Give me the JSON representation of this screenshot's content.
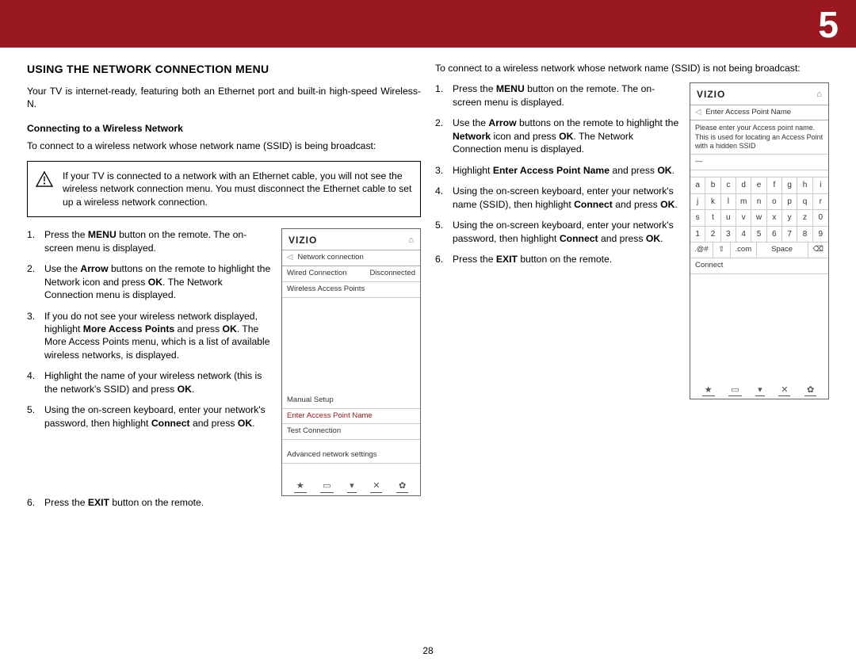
{
  "chapter_number": "5",
  "page_number": "28",
  "section_heading": "USING THE NETWORK CONNECTION MENU",
  "intro": "Your TV is internet-ready, featuring both an Ethernet port and built-in high-speed Wireless-N.",
  "sub1_heading": "Connecting to a Wireless Network",
  "sub1_lead": "To connect to a wireless network whose network name (SSID) is being broadcast:",
  "warning_text": "If your TV is connected to a network with an Ethernet cable, you will not see the wireless network connection menu. You must disconnect the Ethernet cable to set up a wireless network connection.",
  "steps1": [
    {
      "pre": "Press the ",
      "b1": "MENU",
      "post": " button on the remote. The on-screen menu is displayed."
    },
    {
      "pre": "Use the ",
      "b1": "Arrow",
      "mid": " buttons on the remote to highlight the Network icon and press ",
      "b2": "OK",
      "post": ". The Network Connection menu is displayed."
    },
    {
      "pre": "If you do not see your wireless network displayed, highlight ",
      "b1": "More Access Points",
      "mid": " and press ",
      "b2": "OK",
      "post": ". The More Access Points menu, which is a list of available wireless networks, is displayed."
    },
    {
      "pre": "Highlight the name of your wireless network (this is the network's SSID) and press ",
      "b1": "OK",
      "post": "."
    },
    {
      "pre": "Using the on-screen keyboard, enter your network's password, then highlight ",
      "b1": "Connect",
      "mid": " and press ",
      "b2": "OK",
      "post": "."
    },
    {
      "pre": "Press the ",
      "b1": "EXIT",
      "post": " button on the remote."
    }
  ],
  "panel1": {
    "logo": "VIZIO",
    "title": "Network connection",
    "wired_label": "Wired Connection",
    "wired_value": "Disconnected",
    "wireless": "Wireless Access Points",
    "manual": "Manual Setup",
    "enter_ap": "Enter Access Point Name",
    "test": "Test Connection",
    "advanced": "Advanced network settings"
  },
  "col2_lead": "To connect to a wireless network whose network name (SSID) is not being broadcast:",
  "steps2": [
    {
      "pre": "Press the ",
      "b1": "MENU",
      "post": " button on the remote. The on-screen menu is displayed."
    },
    {
      "pre": "Use the ",
      "b1": "Arrow",
      "mid": " buttons on the remote to highlight the ",
      "b2": "Network",
      "mid2": " icon and press ",
      "b3": "OK",
      "post": ". The Network Connection menu is displayed."
    },
    {
      "pre": "Highlight ",
      "b1": "Enter Access Point Name",
      "mid": " and press ",
      "b2": "OK",
      "post": "."
    },
    {
      "pre": "Using the on-screen keyboard, enter your network's name (SSID), then highlight ",
      "b1": "Connect",
      "mid": " and press ",
      "b2": "OK",
      "post": "."
    },
    {
      "pre": "Using the on-screen keyboard, enter your network's password, then highlight ",
      "b1": "Connect",
      "mid": " and press ",
      "b2": "OK",
      "post": "."
    },
    {
      "pre": "Press the ",
      "b1": "EXIT",
      "post": " button on the remote."
    }
  ],
  "panel2": {
    "logo": "VIZIO",
    "title": "Enter Access Point Name",
    "note": "Please enter your Access point name. This is used for locating an Access Point with a hidden SSID",
    "keys_alpha": [
      "a",
      "b",
      "c",
      "d",
      "e",
      "f",
      "g",
      "h",
      "i",
      "j",
      "k",
      "l",
      "m",
      "n",
      "o",
      "p",
      "q",
      "r",
      "s",
      "t",
      "u",
      "v",
      "w",
      "x",
      "y",
      "z",
      "0",
      "1",
      "2",
      "3",
      "4",
      "5",
      "6",
      "7",
      "8",
      "9"
    ],
    "key_sym": ".@#",
    "key_shift": "⇧",
    "key_com": ".com",
    "key_space": "Space",
    "key_del": "⌫",
    "connect": "Connect"
  },
  "toolbar_icons": [
    "★",
    "▭",
    "▾",
    "✕",
    "✿"
  ]
}
